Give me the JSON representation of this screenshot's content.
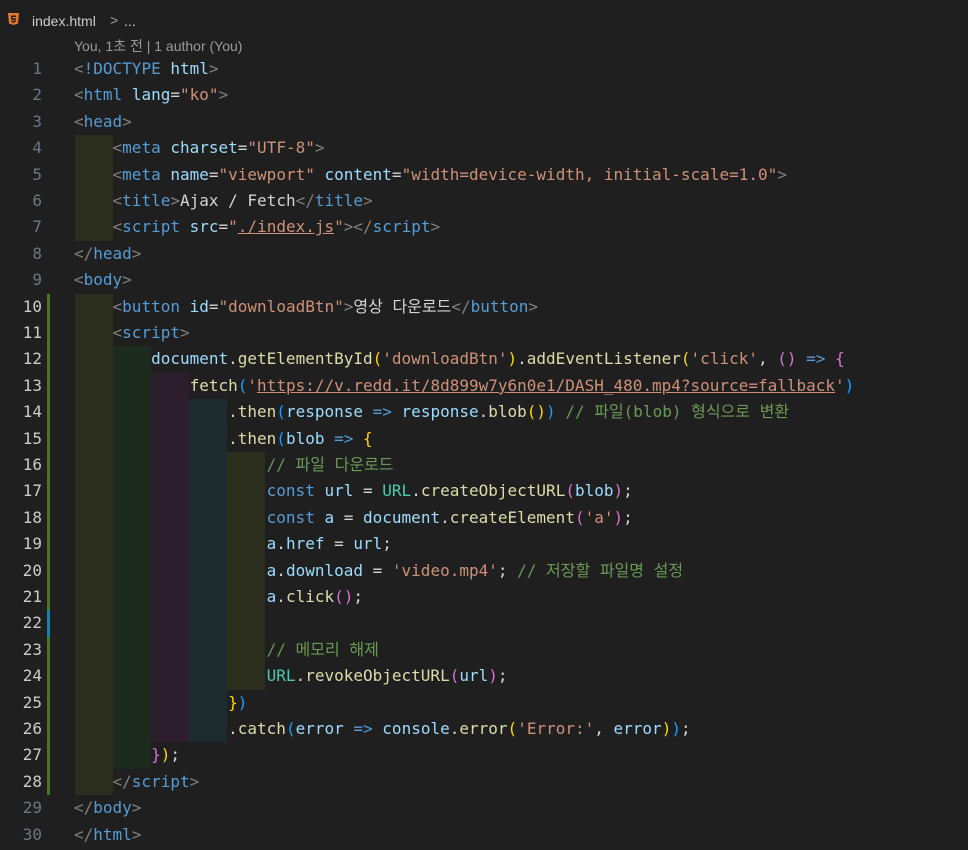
{
  "breadcrumb": {
    "file": "index.html",
    "separator": ">",
    "more": "..."
  },
  "blame": "You, 1초 전 | 1 author (You)",
  "colors": {
    "tag": "#569cd6",
    "attr": "#9cdcfe",
    "string": "#ce9178",
    "comment": "#6a9955",
    "function": "#dcdcaa",
    "class": "#4ec9b0",
    "bracket1": "#ffd700",
    "bracket2": "#da70d6",
    "bracket3": "#179fff",
    "added_gutter": "#48742c",
    "modified_gutter": "#1b81a8"
  },
  "lines": [
    {
      "n": "1",
      "tokens": [
        [
          "t-punct",
          "<"
        ],
        [
          "t-tag",
          "!DOCTYPE"
        ],
        [
          "t-text",
          " "
        ],
        [
          "t-attr",
          "html"
        ],
        [
          "t-punct",
          ">"
        ]
      ]
    },
    {
      "n": "2",
      "tokens": [
        [
          "t-punct",
          "<"
        ],
        [
          "t-tag",
          "html"
        ],
        [
          "t-text",
          " "
        ],
        [
          "t-attr",
          "lang"
        ],
        [
          "t-text",
          "="
        ],
        [
          "t-str",
          "\"ko\""
        ],
        [
          "t-punct",
          ">"
        ]
      ]
    },
    {
      "n": "3",
      "tokens": [
        [
          "t-punct",
          "<"
        ],
        [
          "t-tag",
          "head"
        ],
        [
          "t-punct",
          ">"
        ]
      ]
    },
    {
      "n": "4",
      "tokens": [
        [
          "t-text",
          "    "
        ],
        [
          "t-punct",
          "<"
        ],
        [
          "t-tag",
          "meta"
        ],
        [
          "t-text",
          " "
        ],
        [
          "t-attr",
          "charset"
        ],
        [
          "t-text",
          "="
        ],
        [
          "t-str",
          "\"UTF-8\""
        ],
        [
          "t-punct",
          ">"
        ]
      ]
    },
    {
      "n": "5",
      "tokens": [
        [
          "t-text",
          "    "
        ],
        [
          "t-punct",
          "<"
        ],
        [
          "t-tag",
          "meta"
        ],
        [
          "t-text",
          " "
        ],
        [
          "t-attr",
          "name"
        ],
        [
          "t-text",
          "="
        ],
        [
          "t-str",
          "\"viewport\""
        ],
        [
          "t-text",
          " "
        ],
        [
          "t-attr",
          "content"
        ],
        [
          "t-text",
          "="
        ],
        [
          "t-str",
          "\"width=device-width, initial-scale=1.0\""
        ],
        [
          "t-punct",
          ">"
        ]
      ]
    },
    {
      "n": "6",
      "tokens": [
        [
          "t-text",
          "    "
        ],
        [
          "t-punct",
          "<"
        ],
        [
          "t-tag",
          "title"
        ],
        [
          "t-punct",
          ">"
        ],
        [
          "t-text",
          "Ajax / Fetch"
        ],
        [
          "t-punct",
          "</"
        ],
        [
          "t-tag",
          "title"
        ],
        [
          "t-punct",
          ">"
        ]
      ]
    },
    {
      "n": "7",
      "tokens": [
        [
          "t-text",
          "    "
        ],
        [
          "t-punct",
          "<"
        ],
        [
          "t-tag",
          "script"
        ],
        [
          "t-text",
          " "
        ],
        [
          "t-attr",
          "src"
        ],
        [
          "t-text",
          "="
        ],
        [
          "t-str",
          "\""
        ],
        [
          "t-str t-ul",
          "./index.js"
        ],
        [
          "t-str",
          "\""
        ],
        [
          "t-punct",
          "></"
        ],
        [
          "t-tag",
          "script"
        ],
        [
          "t-punct",
          ">"
        ]
      ]
    },
    {
      "n": "8",
      "tokens": [
        [
          "t-punct",
          "</"
        ],
        [
          "t-tag",
          "head"
        ],
        [
          "t-punct",
          ">"
        ]
      ]
    },
    {
      "n": "9",
      "tokens": [
        [
          "t-punct",
          "<"
        ],
        [
          "t-tag",
          "body"
        ],
        [
          "t-punct",
          ">"
        ]
      ]
    },
    {
      "n": "10",
      "tokens": [
        [
          "t-text",
          "    "
        ],
        [
          "t-punct",
          "<"
        ],
        [
          "t-tag",
          "button"
        ],
        [
          "t-text",
          " "
        ],
        [
          "t-attr",
          "id"
        ],
        [
          "t-text",
          "="
        ],
        [
          "t-str",
          "\"downloadBtn\""
        ],
        [
          "t-punct",
          ">"
        ],
        [
          "t-text",
          "영상 다운로드"
        ],
        [
          "t-punct",
          "</"
        ],
        [
          "t-tag",
          "button"
        ],
        [
          "t-punct",
          ">"
        ]
      ]
    },
    {
      "n": "11",
      "tokens": [
        [
          "t-text",
          "    "
        ],
        [
          "t-punct",
          "<"
        ],
        [
          "t-tag",
          "script"
        ],
        [
          "t-punct",
          ">"
        ]
      ]
    },
    {
      "n": "12",
      "tokens": [
        [
          "t-text",
          "        "
        ],
        [
          "t-var",
          "document"
        ],
        [
          "t-text",
          "."
        ],
        [
          "t-fn",
          "getElementById"
        ],
        [
          "t-b1",
          "("
        ],
        [
          "t-str",
          "'downloadBtn'"
        ],
        [
          "t-b1",
          ")"
        ],
        [
          "t-text",
          "."
        ],
        [
          "t-fn",
          "addEventListener"
        ],
        [
          "t-b1",
          "("
        ],
        [
          "t-str",
          "'click'"
        ],
        [
          "t-text",
          ", "
        ],
        [
          "t-b2",
          "()"
        ],
        [
          "t-text",
          " "
        ],
        [
          "t-kw",
          "=>"
        ],
        [
          "t-text",
          " "
        ],
        [
          "t-b2",
          "{"
        ]
      ]
    },
    {
      "n": "13",
      "tokens": [
        [
          "t-text",
          "            "
        ],
        [
          "t-fn",
          "fetch"
        ],
        [
          "t-b3",
          "("
        ],
        [
          "t-str",
          "'"
        ],
        [
          "t-str t-ul",
          "https://v.redd.it/8d899w7y6n0e1/DASH_480.mp4?source=fallback"
        ],
        [
          "t-str",
          "'"
        ],
        [
          "t-b3",
          ")"
        ]
      ]
    },
    {
      "n": "14",
      "tokens": [
        [
          "t-text",
          "                ."
        ],
        [
          "t-fn",
          "then"
        ],
        [
          "t-b3",
          "("
        ],
        [
          "t-var",
          "response"
        ],
        [
          "t-text",
          " "
        ],
        [
          "t-kw",
          "=>"
        ],
        [
          "t-text",
          " "
        ],
        [
          "t-var",
          "response"
        ],
        [
          "t-text",
          "."
        ],
        [
          "t-fn",
          "blob"
        ],
        [
          "t-b1",
          "()"
        ],
        [
          "t-b3",
          ")"
        ],
        [
          "t-text",
          " "
        ],
        [
          "t-cmt",
          "// 파일(blob) 형식으로 변환"
        ]
      ]
    },
    {
      "n": "15",
      "tokens": [
        [
          "t-text",
          "                ."
        ],
        [
          "t-fn",
          "then"
        ],
        [
          "t-b3",
          "("
        ],
        [
          "t-var",
          "blob"
        ],
        [
          "t-text",
          " "
        ],
        [
          "t-kw",
          "=>"
        ],
        [
          "t-text",
          " "
        ],
        [
          "t-b1",
          "{"
        ]
      ]
    },
    {
      "n": "16",
      "tokens": [
        [
          "t-text",
          "                    "
        ],
        [
          "t-cmt",
          "// 파일 다운로드"
        ]
      ]
    },
    {
      "n": "17",
      "tokens": [
        [
          "t-text",
          "                    "
        ],
        [
          "t-kw",
          "const"
        ],
        [
          "t-text",
          " "
        ],
        [
          "t-var",
          "url"
        ],
        [
          "t-text",
          " = "
        ],
        [
          "t-cls",
          "URL"
        ],
        [
          "t-text",
          "."
        ],
        [
          "t-fn",
          "createObjectURL"
        ],
        [
          "t-b2",
          "("
        ],
        [
          "t-var",
          "blob"
        ],
        [
          "t-b2",
          ")"
        ],
        [
          "t-text",
          ";"
        ]
      ]
    },
    {
      "n": "18",
      "tokens": [
        [
          "t-text",
          "                    "
        ],
        [
          "t-kw",
          "const"
        ],
        [
          "t-text",
          " "
        ],
        [
          "t-var",
          "a"
        ],
        [
          "t-text",
          " = "
        ],
        [
          "t-var",
          "document"
        ],
        [
          "t-text",
          "."
        ],
        [
          "t-fn",
          "createElement"
        ],
        [
          "t-b2",
          "("
        ],
        [
          "t-str",
          "'a'"
        ],
        [
          "t-b2",
          ")"
        ],
        [
          "t-text",
          ";"
        ]
      ]
    },
    {
      "n": "19",
      "tokens": [
        [
          "t-text",
          "                    "
        ],
        [
          "t-var",
          "a"
        ],
        [
          "t-text",
          "."
        ],
        [
          "t-var",
          "href"
        ],
        [
          "t-text",
          " = "
        ],
        [
          "t-var",
          "url"
        ],
        [
          "t-text",
          ";"
        ]
      ]
    },
    {
      "n": "20",
      "tokens": [
        [
          "t-text",
          "                    "
        ],
        [
          "t-var",
          "a"
        ],
        [
          "t-text",
          "."
        ],
        [
          "t-var",
          "download"
        ],
        [
          "t-text",
          " = "
        ],
        [
          "t-str",
          "'video.mp4'"
        ],
        [
          "t-text",
          "; "
        ],
        [
          "t-cmt",
          "// 저장할 파일명 설정"
        ]
      ]
    },
    {
      "n": "21",
      "tokens": [
        [
          "t-text",
          "                    "
        ],
        [
          "t-var",
          "a"
        ],
        [
          "t-text",
          "."
        ],
        [
          "t-fn",
          "click"
        ],
        [
          "t-b2",
          "()"
        ],
        [
          "t-text",
          ";"
        ]
      ]
    },
    {
      "n": "22",
      "tokens": []
    },
    {
      "n": "23",
      "tokens": [
        [
          "t-text",
          "                    "
        ],
        [
          "t-cmt",
          "// 메모리 해제"
        ]
      ]
    },
    {
      "n": "24",
      "tokens": [
        [
          "t-text",
          "                    "
        ],
        [
          "t-cls",
          "URL"
        ],
        [
          "t-text",
          "."
        ],
        [
          "t-fn",
          "revokeObjectURL"
        ],
        [
          "t-b2",
          "("
        ],
        [
          "t-var",
          "url"
        ],
        [
          "t-b2",
          ")"
        ],
        [
          "t-text",
          ";"
        ]
      ]
    },
    {
      "n": "25",
      "tokens": [
        [
          "t-text",
          "                "
        ],
        [
          "t-b1",
          "}"
        ],
        [
          "t-b3",
          ")"
        ]
      ]
    },
    {
      "n": "26",
      "tokens": [
        [
          "t-text",
          "                ."
        ],
        [
          "t-fn",
          "catch"
        ],
        [
          "t-b3",
          "("
        ],
        [
          "t-var",
          "error"
        ],
        [
          "t-text",
          " "
        ],
        [
          "t-kw",
          "=>"
        ],
        [
          "t-text",
          " "
        ],
        [
          "t-var",
          "console"
        ],
        [
          "t-text",
          "."
        ],
        [
          "t-fn",
          "error"
        ],
        [
          "t-b1",
          "("
        ],
        [
          "t-str",
          "'Error:'"
        ],
        [
          "t-text",
          ", "
        ],
        [
          "t-var",
          "error"
        ],
        [
          "t-b1",
          ")"
        ],
        [
          "t-b3",
          ")"
        ],
        [
          "t-text",
          ";"
        ]
      ]
    },
    {
      "n": "27",
      "tokens": [
        [
          "t-text",
          "        "
        ],
        [
          "t-b2",
          "}"
        ],
        [
          "t-b1",
          ")"
        ],
        [
          "t-text",
          ";"
        ]
      ]
    },
    {
      "n": "28",
      "tokens": [
        [
          "t-text",
          "    "
        ],
        [
          "t-punct",
          "</"
        ],
        [
          "t-tag",
          "script"
        ],
        [
          "t-punct",
          ">"
        ]
      ]
    },
    {
      "n": "29",
      "tokens": [
        [
          "t-punct",
          "</"
        ],
        [
          "t-tag",
          "body"
        ],
        [
          "t-punct",
          ">"
        ]
      ]
    },
    {
      "n": "30",
      "tokens": [
        [
          "t-punct",
          "</"
        ],
        [
          "t-tag",
          "html"
        ],
        [
          "t-punct",
          ">"
        ]
      ]
    }
  ]
}
